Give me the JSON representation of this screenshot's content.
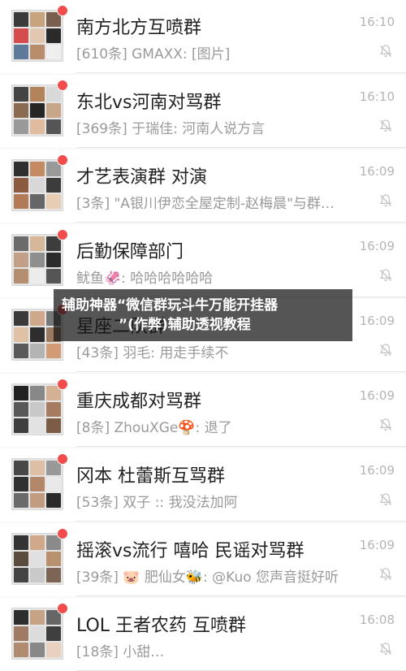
{
  "chats": [
    {
      "name": "南方北方互喷群",
      "preview": "[610条] GMAXX: [图片]",
      "time": "16:10",
      "avatar_colors": [
        "#3b3b3b",
        "#c9a27e",
        "#7a5f4f",
        "#d64b4b",
        "#e2c7b2",
        "#2a2a2a",
        "#5d7a9a",
        "#b98d6c",
        "#efefef"
      ]
    },
    {
      "name": "东北vs河南对骂群",
      "preview": "[369条] 于瑞佳: 河南人说方言",
      "time": "16:10",
      "avatar_colors": [
        "#444",
        "#b3835c",
        "#d9d9d9",
        "#8a6b52",
        "#262626",
        "#c7a68a",
        "#999",
        "#e0bba0",
        "#555"
      ]
    },
    {
      "name": "才艺表演群  对演",
      "preview": "[3条] \"A银川伊恋全屋定制-赵梅晨\"与群…",
      "time": "16:09",
      "avatar_colors": [
        "#2f2f2f",
        "#c48b63",
        "#999",
        "#8c5a3f",
        "#d8d8d8",
        "#3c3c3c",
        "#b37a58",
        "#666",
        "#e7cdb4"
      ]
    },
    {
      "name": "后勤保障部门",
      "preview": "鱿鱼🦑: 哈哈哈哈哈哈",
      "time": "16:09",
      "avatar_colors": [
        "#6b6b6b",
        "#d7b79a",
        "#3d3d3d",
        "#c2a088",
        "#8e8e8e",
        "#2b2b2b",
        "#b58d6f",
        "#ececec",
        "#555"
      ]
    },
    {
      "name": "星座二队群",
      "preview": "[43条] 羽毛: 用走手续不",
      "time": "16:09",
      "avatar_colors": [
        "#3a3a3a",
        "#cfa78a",
        "#777",
        "#e1c1a6",
        "#2d2d2d",
        "#9b7a62",
        "#5a5a5a",
        "#b4b4b4",
        "#d39a76"
      ]
    },
    {
      "name": "重庆成都对骂群",
      "preview": "[8条] ZhouXGe🍄: 退了",
      "time": "16:09",
      "avatar_colors": [
        "#222",
        "#888",
        "#d4b095",
        "#595959",
        "#c8c8c8",
        "#a57c60",
        "#3e3e3e",
        "#e2e2e2",
        "#7d5c47"
      ]
    },
    {
      "name": "冈本 杜蕾斯互骂群",
      "preview": "[53条] 双子        :: 我没法加阿",
      "time": "16:09",
      "avatar_colors": [
        "#474747",
        "#dcbfa5",
        "#999",
        "#303030",
        "#b3876a",
        "#e9e9e9",
        "#6a6a6a",
        "#c29c80",
        "#2a2a2a"
      ]
    },
    {
      "name": "摇滚vs流行 嘻哈 民谣对骂群",
      "preview": "[39条] 🐷 肥仙女🐝: @Kuo 您声音挺好听",
      "time": "16:09",
      "avatar_colors": [
        "#333",
        "#d0a98b",
        "#8a8a8a",
        "#5b4a3e",
        "#e0e0e0",
        "#b8916f",
        "#444",
        "#c9c9c9",
        "#7c6555"
      ]
    },
    {
      "name": "LOL 王者农药 互喷群",
      "preview": "[18条] 小甜…",
      "time": "16:08",
      "avatar_colors": [
        "#2e2e2e",
        "#c7a386",
        "#666",
        "#9e7b62",
        "#dcdcdc",
        "#3f3f3f",
        "#b08b70",
        "#888",
        "#e8d2bf"
      ]
    }
  ],
  "overlay": {
    "line1": "辅助神器“微信群玩斗牛万能开挂器",
    "line2": "”(作弊)辅助透视教程"
  },
  "icons": {
    "muted": "bell-slash-icon",
    "unread": "unread-dot"
  },
  "colors": {
    "unread_dot": "#f24c4c",
    "time": "#b5b5b5",
    "preview": "#9a9a9a"
  }
}
